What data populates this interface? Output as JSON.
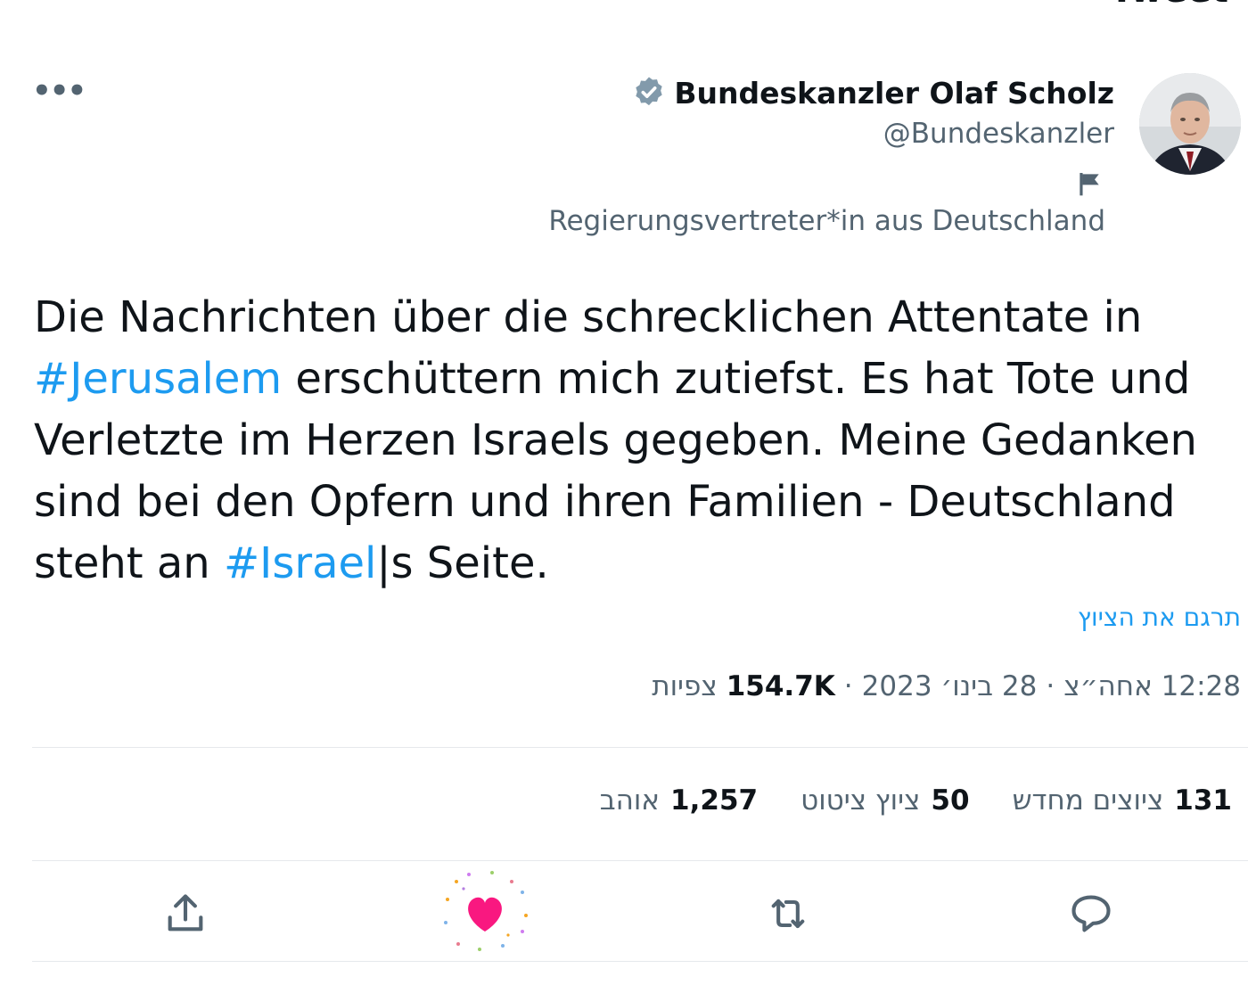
{
  "top_title": "Tweet",
  "author": {
    "display_name": "Bundeskanzler Olaf Scholz",
    "handle": "@Bundeskanzler",
    "label": "Regierungsvertreter*in aus Deutschland"
  },
  "tweet": {
    "text_part1": "Die Nachrichten über die schrecklichen Attentate in ",
    "hashtag1": "#Jerusalem",
    "text_part2": " erschüttern mich zutiefst. Es hat Tote und Verletzte im Herzen Israels gegeben. Meine Gedanken sind bei den Opfern und ihren Familien - Deutschland steht an ",
    "hashtag2": "#Israel",
    "text_part3": "|s Seite."
  },
  "translate_label": "תרגם את הציוץ",
  "meta": {
    "time": "12:28 אחה״צ",
    "sep1": "·",
    "date": "28 בינו׳ 2023",
    "sep2": "·",
    "views_count": "154.7K",
    "views_label": "צפיות"
  },
  "stats": {
    "retweets_count": "131",
    "retweets_label": "ציוצים מחדש",
    "quotes_count": "50",
    "quotes_label": "ציוץ ציטוט",
    "likes_count": "1,257",
    "likes_label": "אוהב"
  },
  "icons": {
    "more": "more-icon",
    "verified": "verified-badge-icon",
    "flag": "flag-icon",
    "reply": "reply-icon",
    "retweet": "retweet-icon",
    "like": "heart-icon",
    "share": "share-icon"
  },
  "colors": {
    "link": "#1d9bf0",
    "muted": "#536471",
    "text": "#0f1419",
    "like": "#f91880",
    "verified": "#829aab"
  }
}
